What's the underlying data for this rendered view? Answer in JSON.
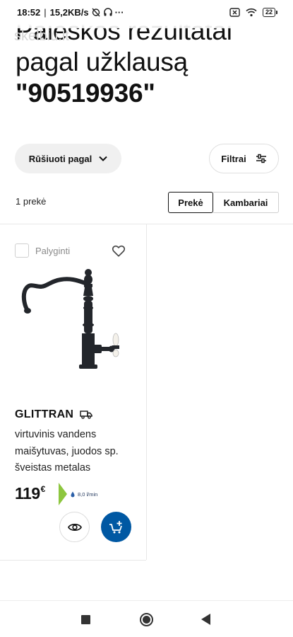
{
  "status_bar": {
    "time": "18:52",
    "speed": "15,2KB/s",
    "more": "···",
    "battery": "22"
  },
  "header": {
    "title_line1": "Paieškos rezultatai",
    "title_line2": "pagal užklausą",
    "query": "\"90519936\"",
    "watermark": "skelbiu.lt"
  },
  "controls": {
    "sort_label": "Rūšiuoti pagal",
    "filter_label": "Filtrai",
    "count_label": "1 prekė",
    "toggle": [
      "Prekė",
      "Kambariai"
    ]
  },
  "product": {
    "compare_label": "Palyginti",
    "name": "GLITTRAN",
    "description": "virtuvinis vandens maišytuvas, juodos sp. šveistas metalas",
    "price": "119",
    "currency": "€",
    "flow": "8,0 l/min"
  },
  "colors": {
    "accent": "#0058a3",
    "eco": "#8dc63f",
    "pill": "#f0f0f0"
  },
  "icons": {
    "sort": "chevron-down-icon",
    "filter": "sliders-icon",
    "wishlist": "heart-icon",
    "delivery": "truck-icon",
    "quick_view": "eye-icon",
    "add_to_cart": "cart-plus-icon"
  }
}
